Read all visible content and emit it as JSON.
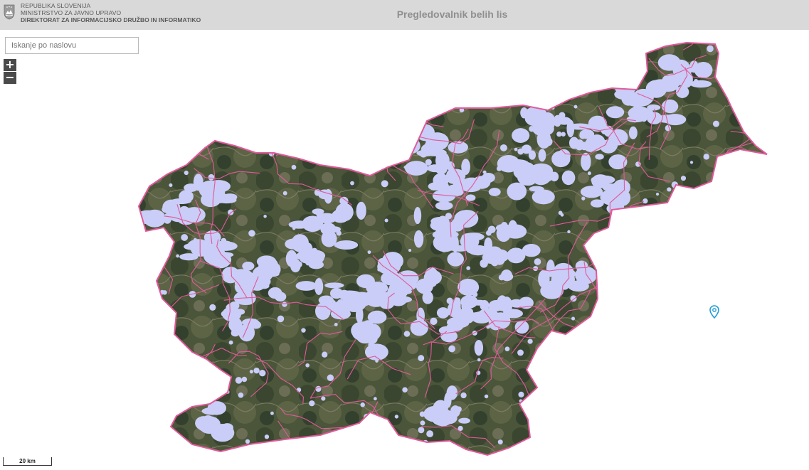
{
  "header": {
    "org_line1": "REPUBLIKA SLOVENIJA",
    "org_line2": "MINISTRSTVO ZA JAVNO UPRAVO",
    "org_line3": "DIREKTORAT ZA INFORMACIJSKO DRUŽBO IN INFORMATIKO",
    "title": "Pregledovalnik belih lis"
  },
  "search": {
    "placeholder": "Iskanje po naslovu",
    "value": ""
  },
  "zoom": {
    "in_label": "+",
    "out_label": "−"
  },
  "scale": {
    "label": "20 km"
  },
  "map": {
    "region": "Slovenia",
    "boundary_color": "#e05a9a",
    "white_spot_color": "#c9cdf7",
    "terrain_colors": [
      "#3e4a34",
      "#55603f",
      "#2f3a2c",
      "#6a6d52"
    ],
    "marker_icon": "location-pin-icon",
    "marker_color": "#1f9bd8"
  }
}
